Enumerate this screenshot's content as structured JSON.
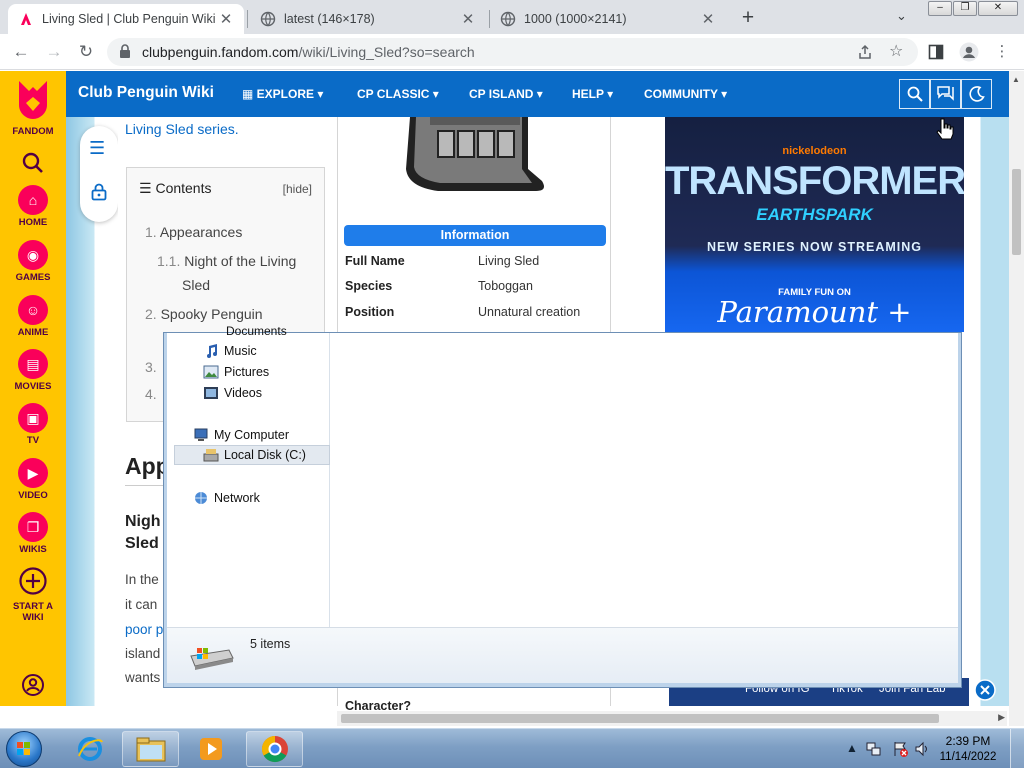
{
  "browser": {
    "tabs": [
      {
        "title": "Living Sled | Club Penguin Wiki |",
        "active": true
      },
      {
        "title": "latest (146×178)",
        "active": false
      },
      {
        "title": "1000 (1000×2141)",
        "active": false
      }
    ],
    "new_tab_label": "+",
    "url_host": "clubpenguin.fandom.com",
    "url_path": "/wiki/Living_Sled?so=search",
    "window_buttons": [
      "–",
      "❐",
      "✕"
    ]
  },
  "fandom_rail": {
    "brand": "FANDOM",
    "items": [
      {
        "label": "HOME",
        "icon": "home-icon"
      },
      {
        "label": "GAMES",
        "icon": "games-icon"
      },
      {
        "label": "ANIME",
        "icon": "anime-icon"
      },
      {
        "label": "MOVIES",
        "icon": "movies-icon"
      },
      {
        "label": "TV",
        "icon": "tv-icon"
      },
      {
        "label": "VIDEO",
        "icon": "video-icon"
      },
      {
        "label": "WIKIS",
        "icon": "wikis-icon"
      },
      {
        "label": "START A WIKI",
        "icon": "plus-icon"
      }
    ]
  },
  "wiki_header": {
    "title": "Club Penguin Wiki",
    "nav": [
      "EXPLORE",
      "CP CLASSIC",
      "CP ISLAND",
      "HELP",
      "COMMUNITY"
    ]
  },
  "article": {
    "intro_link": "Living Sled series.",
    "toc": {
      "heading": "Contents",
      "hide": "[hide]",
      "entries": [
        {
          "num": "1.",
          "text": "Appearances"
        },
        {
          "num": "1.1.",
          "text": "Night of the Living"
        },
        {
          "num": "",
          "text": "Sled"
        },
        {
          "num": "2.",
          "text": "Spooky Penguin"
        },
        {
          "num": "3.",
          "text": ""
        },
        {
          "num": "4.",
          "text": ""
        }
      ]
    },
    "heading_partial": "App",
    "subheading_partial_1": "Nigh",
    "subheading_partial_2": "Sled",
    "body_partial": [
      "In the",
      "it can",
      "poor p",
      "island",
      "wants"
    ]
  },
  "infobox": {
    "header": "Information",
    "rows": [
      {
        "key": "Full Name",
        "value": "Living Sled",
        "link": false
      },
      {
        "key": "Species",
        "value": "Toboggan",
        "link": true
      },
      {
        "key": "Position",
        "value": "Unnatural creation",
        "link": false
      }
    ],
    "bottom_key": "Character?"
  },
  "ad": {
    "brand": "nickelodeon",
    "title": "TRANSFORMERS",
    "subtitle": "EARTHSPARK",
    "line": "NEW SERIES NOW STREAMING",
    "family": "FAMILY FUN ON",
    "platform": "Paramount +"
  },
  "social_bar": {
    "items": [
      "Follow on IG",
      "TikTok",
      "Join Fan Lab"
    ]
  },
  "explorer": {
    "tree": [
      {
        "label": "Music",
        "icon": "music-icon"
      },
      {
        "label": "Pictures",
        "icon": "pictures-icon"
      },
      {
        "label": "Videos",
        "icon": "videos-icon"
      },
      {
        "label": "My Computer",
        "icon": "computer-icon"
      },
      {
        "label": "Local Disk (C:)",
        "icon": "disk-icon",
        "selected": true
      },
      {
        "label": "Network",
        "icon": "network-icon"
      }
    ],
    "partial_top_item": "Documents",
    "items_count": "5 items"
  },
  "taskbar": {
    "time": "2:39 PM",
    "date": "11/14/2022",
    "apps": [
      "internet-explorer-icon",
      "file-explorer-icon",
      "media-player-icon",
      "chrome-icon"
    ]
  },
  "colors": {
    "fandom_yellow": "#ffc500",
    "wiki_blue": "#0a6bc7",
    "info_blue": "#1f7dea"
  }
}
